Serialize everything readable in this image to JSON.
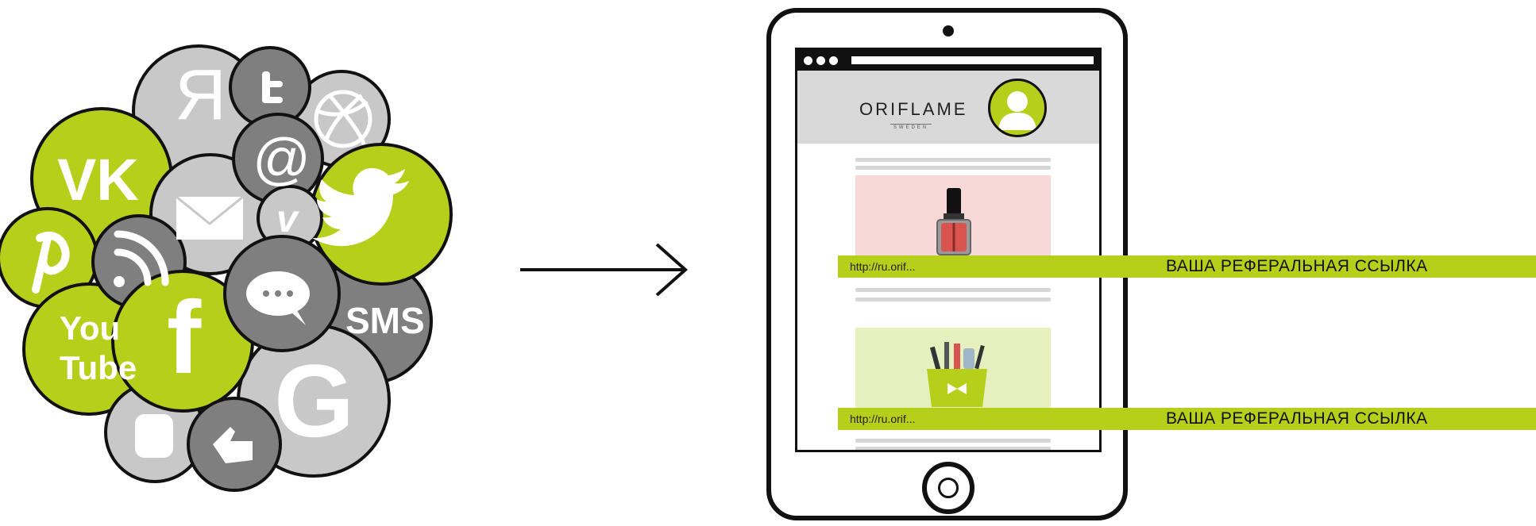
{
  "social_cluster": {
    "icons": {
      "yandex": "Я",
      "at": "@",
      "vimeo": "v",
      "sms": "SMS",
      "youtube_top": "You",
      "youtube_bottom": "Tube",
      "google": "G",
      "facebook": "f",
      "vk": "VK",
      "chat": "•••"
    },
    "colors": {
      "green": "#b5cf1a",
      "dark_grey": "#7f7f7f",
      "light_grey": "#c8c8c8",
      "outline": "#111111"
    }
  },
  "tablet": {
    "brand": {
      "name": "ORIFLAME",
      "sub": "SWEDEN"
    },
    "cards": [
      {
        "url": "http://ru.orif..."
      },
      {
        "url": "http://ru.orif..."
      }
    ]
  },
  "referral": {
    "label_1": "ВАША РЕФЕРАЛЬНАЯ ССЫЛКА",
    "label_2": "ВАША РЕФЕРАЛЬНАЯ ССЫЛКА",
    "accent": "#b5cf1a"
  }
}
